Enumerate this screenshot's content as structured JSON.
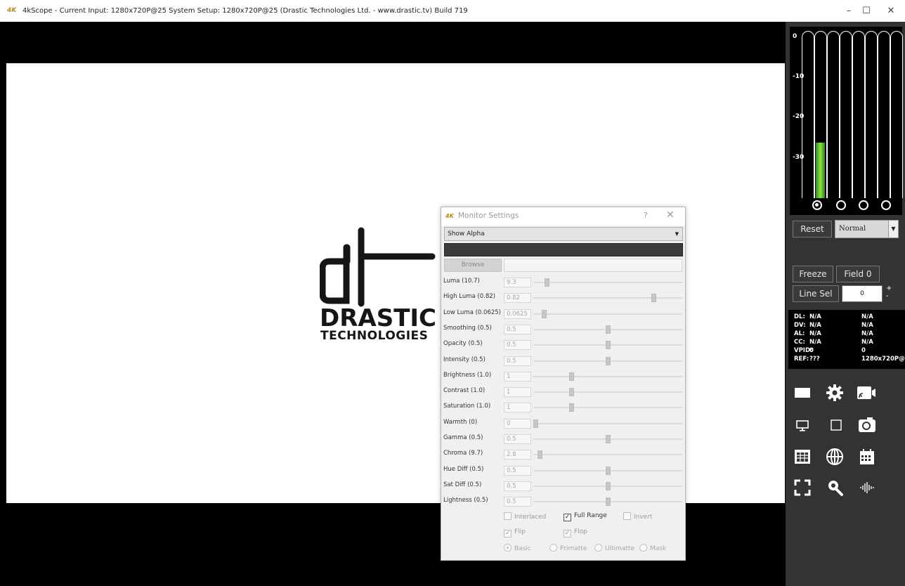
{
  "titlebar": {
    "logo_text": "4K",
    "title": "4kScope -  Current Input: 1280x720P@25  System Setup: 1280x720P@25    (Drastic Technologies Ltd. - www.drastic.tv) Build 719",
    "minimize": "–",
    "maximize": "☐",
    "close": "✕"
  },
  "logo": {
    "line1": "DRASTIC",
    "line2": "TECHNOLOGIES"
  },
  "meter": {
    "labels": [
      "0",
      "-10",
      "-20",
      "-30"
    ],
    "level": 0.33
  },
  "panel": {
    "reset": "Reset",
    "mode": "Normal",
    "freeze": "Freeze",
    "field": "Field 0",
    "line_sel": "Line Sel",
    "line_value": "0",
    "plus": "+",
    "minus": "-"
  },
  "info": [
    {
      "k": "DL:",
      "v1": "N/A",
      "v2": "N/A"
    },
    {
      "k": "DV:",
      "v1": "N/A",
      "v2": "N/A"
    },
    {
      "k": "AL:",
      "v1": "N/A",
      "v2": "N/A"
    },
    {
      "k": "CC:",
      "v1": "N/A",
      "v2": "N/A"
    },
    {
      "k": "VPID:",
      "v1": "0",
      "v2": "0"
    },
    {
      "k": "REF:",
      "v1": "???",
      "v2": "1280x720P@25"
    }
  ],
  "toolbar_icons": [
    "monitor-window-icon",
    "settings-gear-icon",
    "cast-camera-icon",
    "display-icon",
    "square-outline-icon",
    "camera-icon",
    "table-icon",
    "globe-icon",
    "calendar-icon",
    "fullscreen-icon",
    "search-icon",
    "audio-waveform-icon"
  ],
  "colors": {
    "meter_green": "#8ee04b",
    "panel_bg": "#333333",
    "dialog_accent": "#b7881a"
  },
  "dialog": {
    "title": "Monitor Settings",
    "help": "?",
    "close": "✕",
    "select": "Show Alpha",
    "browse": "Browse",
    "sliders": [
      {
        "label": "Luma (10.7)",
        "value": "9.3",
        "pos": 0.08
      },
      {
        "label": "High Luma (0.82)",
        "value": "0.82",
        "pos": 0.82
      },
      {
        "label": "Low Luma (0.0625)",
        "value": "0.0625",
        "pos": 0.06
      },
      {
        "label": "Smoothing (0.5)",
        "value": "0.5",
        "pos": 0.5
      },
      {
        "label": "Opacity (0.5)",
        "value": "0.5",
        "pos": 0.5
      },
      {
        "label": "Intensity (0.5)",
        "value": "0.5",
        "pos": 0.5
      },
      {
        "label": "Brightness (1.0)",
        "value": "1",
        "pos": 0.25
      },
      {
        "label": "Contrast (1.0)",
        "value": "1",
        "pos": 0.25
      },
      {
        "label": "Saturation (1.0)",
        "value": "1",
        "pos": 0.25
      },
      {
        "label": "Warmth (0)",
        "value": "0",
        "pos": 0.0
      },
      {
        "label": "Gamma (0.5)",
        "value": "0.5",
        "pos": 0.5
      },
      {
        "label": "Chroma (9.7)",
        "value": "2.8",
        "pos": 0.03
      },
      {
        "label": "Hue Diff (0.5)",
        "value": "0.5",
        "pos": 0.5
      },
      {
        "label": "Sat Diff (0.5)",
        "value": "0.5",
        "pos": 0.5
      },
      {
        "label": "Lightness (0.5)",
        "value": "0.5",
        "pos": 0.5
      }
    ],
    "interlaced": "Interlaced",
    "full_range": "Full Range",
    "invert": "Invert",
    "flip": "Flip",
    "flop": "Flop",
    "radios": [
      "Basic",
      "Primatte",
      "Ultimatte",
      "Mask"
    ]
  }
}
